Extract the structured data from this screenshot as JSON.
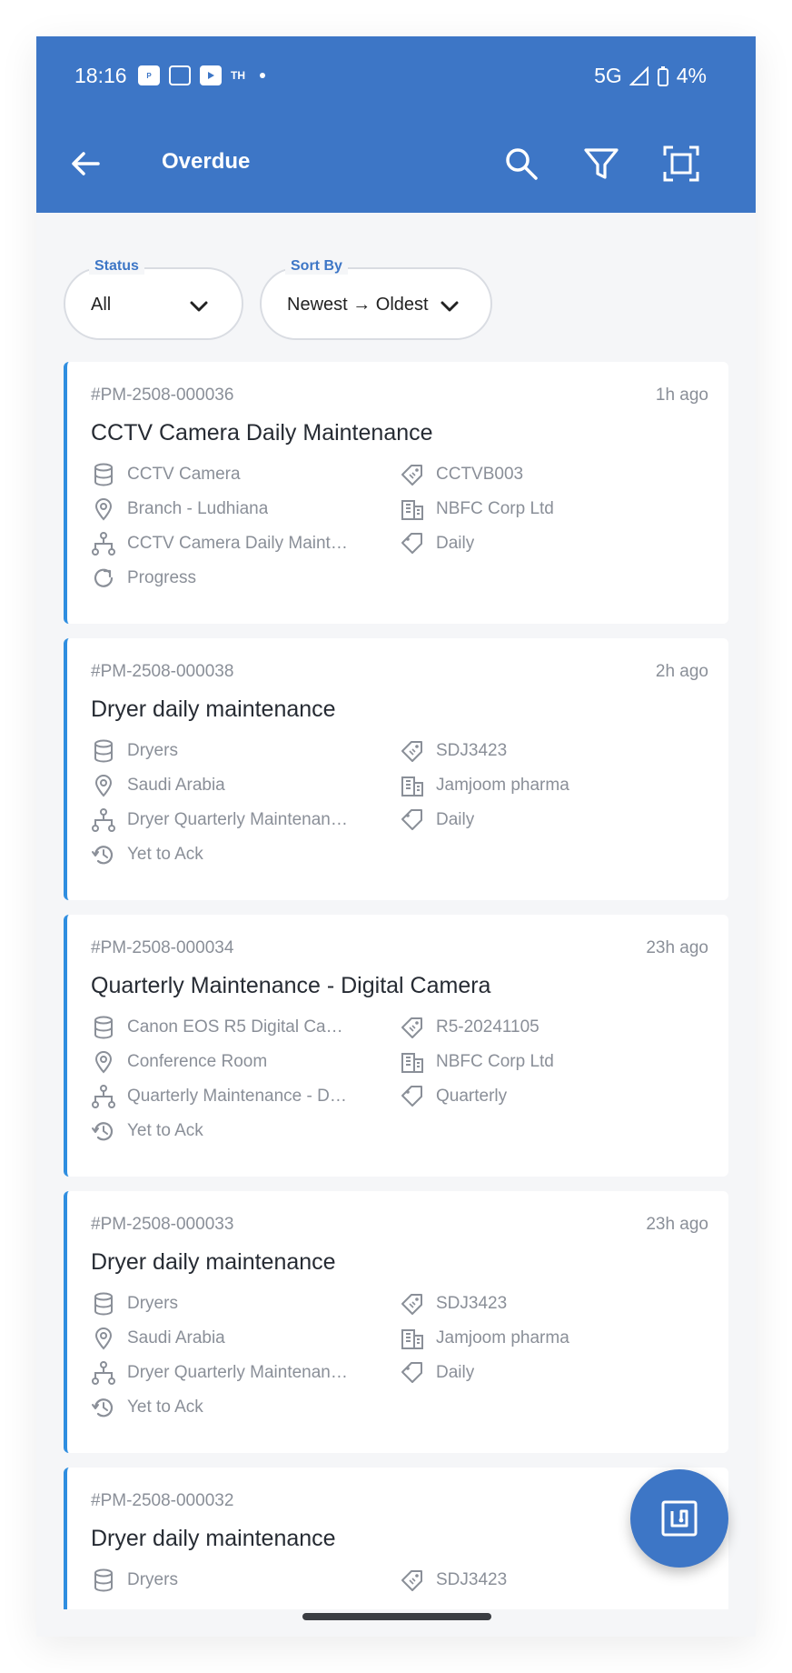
{
  "status_bar": {
    "time": "18:16",
    "notif_text": "TH",
    "network": "5G",
    "battery": "4%"
  },
  "app_bar": {
    "title": "Overdue"
  },
  "filters": {
    "status": {
      "label": "Status",
      "value": "All"
    },
    "sort": {
      "label": "Sort By",
      "value": "Newest → Oldest"
    }
  },
  "cards": [
    {
      "id": "#PM-2508-000036",
      "time": "1h ago",
      "title": "CCTV Camera Daily Maintenance",
      "asset": "CCTV Camera",
      "code": "CCTVB003",
      "location": "Branch - Ludhiana",
      "company": "NBFC Corp Ltd",
      "schedule": "CCTV Camera Daily Maint…",
      "frequency": "Daily",
      "status": "Progress"
    },
    {
      "id": "#PM-2508-000038",
      "time": "2h ago",
      "title": "Dryer daily maintenance",
      "asset": "Dryers",
      "code": "SDJ3423",
      "location": "Saudi Arabia",
      "company": "Jamjoom pharma",
      "schedule": "Dryer Quarterly Maintenan…",
      "frequency": "Daily",
      "status": "Yet to Ack"
    },
    {
      "id": "#PM-2508-000034",
      "time": "23h ago",
      "title": "Quarterly Maintenance - Digital Camera",
      "asset": "Canon EOS R5 Digital Ca…",
      "code": "R5-20241105",
      "location": "Conference Room",
      "company": "NBFC Corp Ltd",
      "schedule": "Quarterly Maintenance - D…",
      "frequency": "Quarterly",
      "status": "Yet to Ack"
    },
    {
      "id": "#PM-2508-000033",
      "time": "23h ago",
      "title": "Dryer daily maintenance",
      "asset": "Dryers",
      "code": "SDJ3423",
      "location": "Saudi Arabia",
      "company": "Jamjoom pharma",
      "schedule": "Dryer Quarterly Maintenan…",
      "frequency": "Daily",
      "status": "Yet to Ack"
    },
    {
      "id": "#PM-2508-000032",
      "title": "Dryer daily maintenance",
      "asset": "Dryers",
      "code": "SDJ3423"
    }
  ],
  "colors": {
    "primary": "#3d76c6",
    "card_accent": "#2f8ee0",
    "muted_text": "#8a8f98"
  }
}
